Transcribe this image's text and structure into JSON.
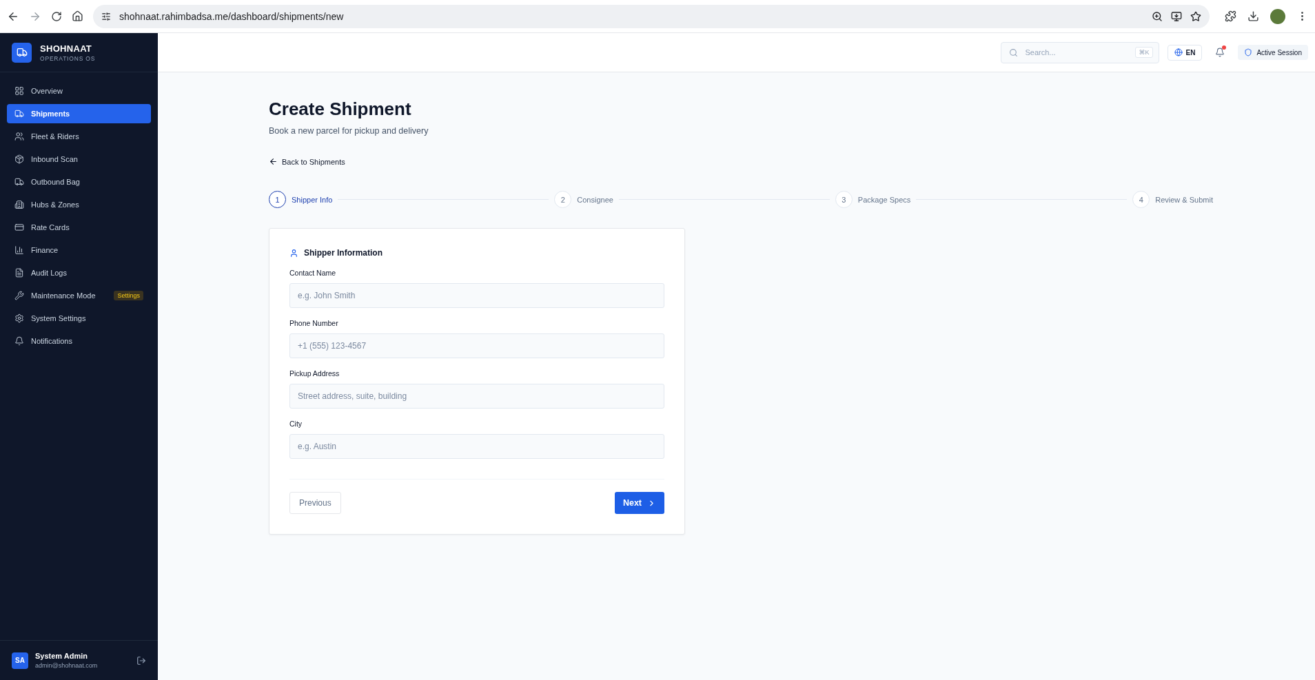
{
  "browser": {
    "url": "shohnaat.rahimbadsa.me/dashboard/shipments/new"
  },
  "sidebar": {
    "brand": "SHOHNAAT",
    "tagline": "OPERATIONS OS",
    "items": [
      {
        "kind": "overview",
        "label": "Overview",
        "selected": false
      },
      {
        "kind": "shipments",
        "label": "Shipments",
        "selected": true
      },
      {
        "kind": "fleet",
        "label": "Fleet & Riders",
        "selected": false
      },
      {
        "kind": "inbound",
        "label": "Inbound Scan",
        "selected": false
      },
      {
        "kind": "outbound",
        "label": "Outbound Bag",
        "selected": false
      },
      {
        "kind": "hubs",
        "label": "Hubs & Zones",
        "selected": false
      },
      {
        "kind": "rates",
        "label": "Rate Cards",
        "selected": false
      },
      {
        "kind": "finance",
        "label": "Finance",
        "selected": false
      },
      {
        "kind": "audit",
        "label": "Audit Logs",
        "selected": false
      },
      {
        "kind": "maintenance",
        "label": "Maintenance Mode",
        "selected": false,
        "badge": "Settings"
      },
      {
        "kind": "settings",
        "label": "System Settings",
        "selected": false
      },
      {
        "kind": "notifications",
        "label": "Notifications",
        "selected": false
      }
    ],
    "user": {
      "initials": "SA",
      "name": "System Admin",
      "email": "admin@shohnaat.com"
    }
  },
  "header": {
    "search": {
      "placeholder": "Search...",
      "shortcut": "⌘K"
    },
    "language": "EN",
    "notification_dot": true,
    "session": "Active Session"
  },
  "page": {
    "title": "Create Shipment",
    "subtitle": "Book a new parcel for pickup and delivery",
    "back_link": "Back to Shipments"
  },
  "steps": [
    {
      "number": "1",
      "label": "Shipper Info",
      "selected": true
    },
    {
      "number": "2",
      "label": "Consignee",
      "selected": false
    },
    {
      "number": "3",
      "label": "Package Specs",
      "selected": false
    },
    {
      "number": "4",
      "label": "Review & Submit",
      "selected": false
    }
  ],
  "form": {
    "title": "Shipper Information",
    "fields": [
      {
        "label": "Contact Name",
        "placeholder": "e.g. John Smith"
      },
      {
        "label": "Phone Number",
        "placeholder": "+1 (555) 123-4567"
      },
      {
        "label": "Pickup Address",
        "placeholder": "Street address, suite, building"
      },
      {
        "label": "City",
        "placeholder": "e.g. Austin"
      }
    ],
    "previous": "Previous",
    "next": "Next"
  }
}
